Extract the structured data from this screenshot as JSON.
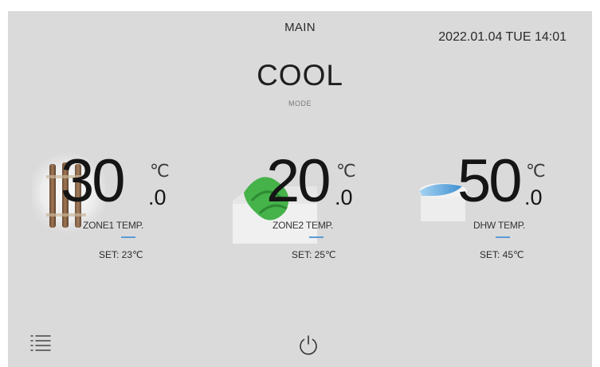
{
  "header": {
    "title": "MAIN",
    "datetime": "2022.01.04 TUE 14:01"
  },
  "mode": {
    "value": "COOL",
    "label": "MODE"
  },
  "zones": [
    {
      "temp_int": "30",
      "temp_dec": ".0",
      "unit": "℃",
      "label": "ZONE1 TEMP.",
      "set": "SET: 23℃",
      "icon": "radiator-icon"
    },
    {
      "temp_int": "20",
      "temp_dec": ".0",
      "unit": "℃",
      "label": "ZONE2 TEMP.",
      "set": "SET: 25℃",
      "icon": "floor-heating-icon"
    },
    {
      "temp_int": "50",
      "temp_dec": ".0",
      "unit": "℃",
      "label": "DHW TEMP.",
      "set": "SET: 45℃",
      "icon": "hot-water-icon"
    }
  ],
  "footer": {
    "menu_icon": "menu-icon",
    "power_icon": "power-icon"
  },
  "colors": {
    "background": "#dadada",
    "accent_dash": "#5b9bd5"
  }
}
